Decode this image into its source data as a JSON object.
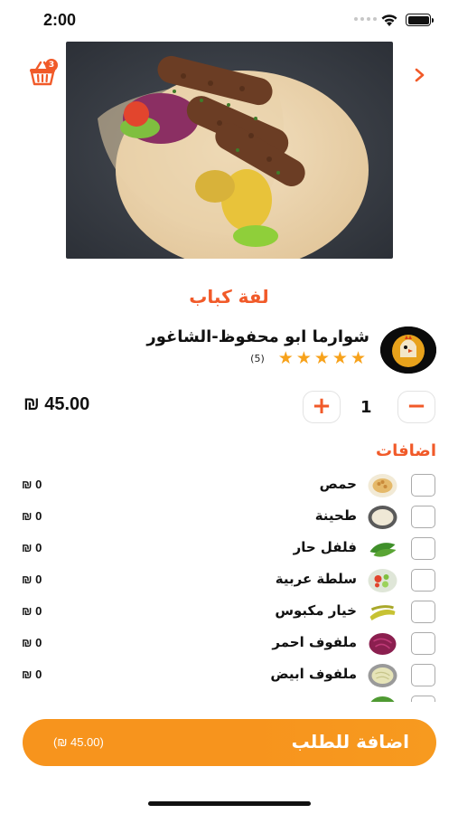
{
  "status_bar": {
    "time": "2:00"
  },
  "cart": {
    "badge_count": "3"
  },
  "product": {
    "title": "لفة كباب",
    "restaurant_name": "شوارما ابو محفوظ-الشاغور",
    "rating_stars": 5,
    "rating_count": "(5)",
    "price": "₪ 45.00",
    "quantity": "1"
  },
  "qty_controls": {
    "plus_label": "+",
    "minus_label": "−"
  },
  "extras": {
    "title": "اضافات",
    "items": [
      {
        "name": "حمص",
        "price": "₪ 0",
        "thumb": "hummus"
      },
      {
        "name": "طحينة",
        "price": "₪ 0",
        "thumb": "tahini"
      },
      {
        "name": "فلفل حار",
        "price": "₪ 0",
        "thumb": "hot-pepper"
      },
      {
        "name": "سلطة عربية",
        "price": "₪ 0",
        "thumb": "arabic-salad"
      },
      {
        "name": "خيار مكبوس",
        "price": "₪ 0",
        "thumb": "pickles"
      },
      {
        "name": "ملفوف احمر",
        "price": "₪ 0",
        "thumb": "red-cabbage"
      },
      {
        "name": "ملفوف ابيض",
        "price": "₪ 0",
        "thumb": "white-cabbage"
      }
    ]
  },
  "footer": {
    "add_button_label": "اضافة للطلب",
    "add_button_total": "(₪ 45.00)"
  },
  "colors": {
    "accent": "#f15a29",
    "button": "#f7941d",
    "star": "#f7a21b"
  }
}
